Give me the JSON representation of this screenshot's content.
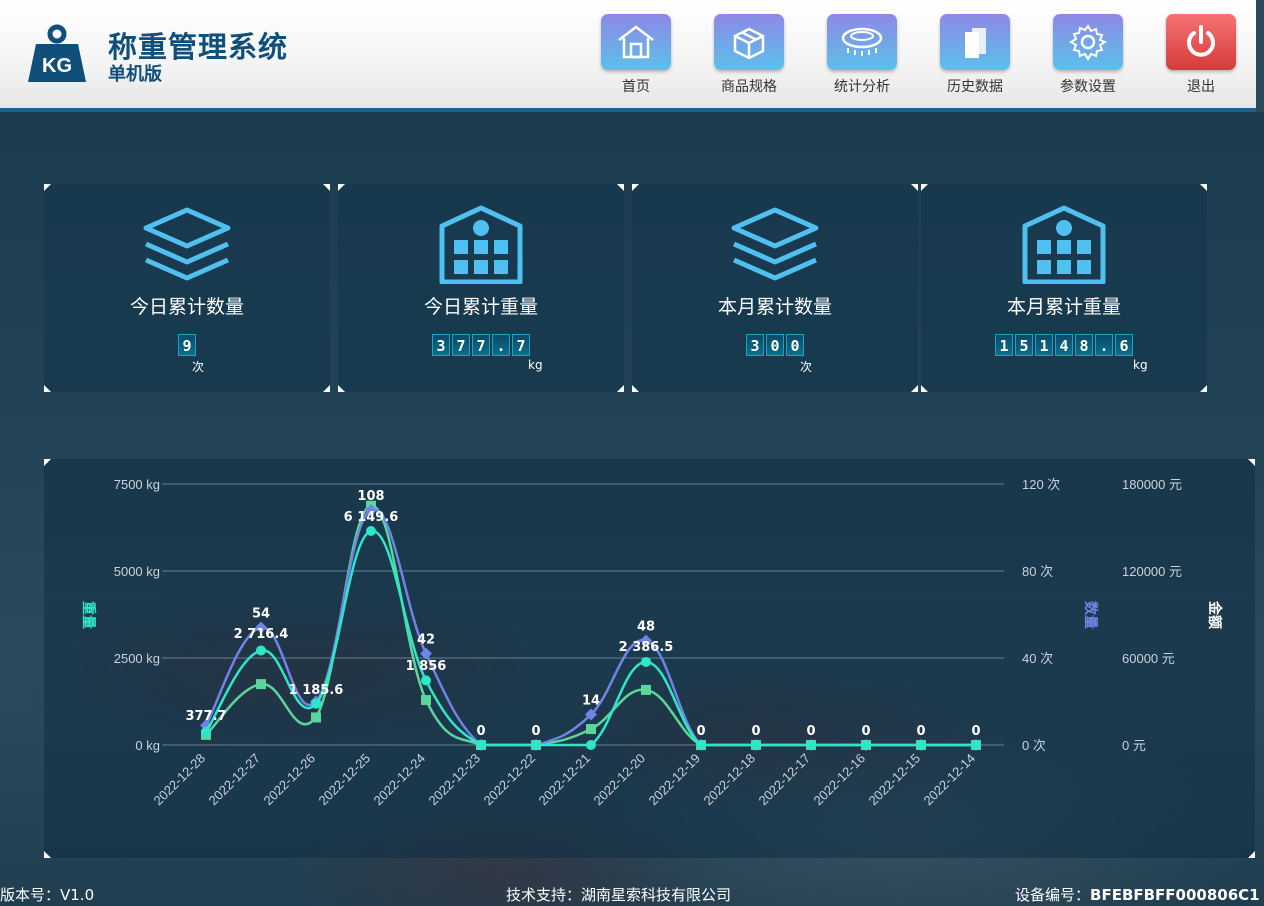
{
  "app": {
    "title": "称重管理系统",
    "subtitle": "单机版",
    "logo_text": "KG"
  },
  "nav": [
    {
      "label": "首页",
      "icon": "home-icon"
    },
    {
      "label": "商品规格",
      "icon": "box-icon"
    },
    {
      "label": "统计分析",
      "icon": "scale-icon"
    },
    {
      "label": "历史数据",
      "icon": "documents-icon"
    },
    {
      "label": "参数设置",
      "icon": "gear-icon"
    },
    {
      "label": "退出",
      "icon": "power-icon",
      "color": "#e04848"
    }
  ],
  "stats": [
    {
      "label": "今日累计数量",
      "digits": [
        "9"
      ],
      "unit": "次",
      "icon": "layers-icon"
    },
    {
      "label": "今日累计重量",
      "digits": [
        "3",
        "7",
        "7",
        ".",
        "7"
      ],
      "unit": "kg",
      "icon": "building-icon"
    },
    {
      "label": "本月累计数量",
      "digits": [
        "3",
        "0",
        "0"
      ],
      "unit": "次",
      "icon": "layers-icon"
    },
    {
      "label": "本月累计重量",
      "digits": [
        "1",
        "5",
        "1",
        "4",
        "8",
        ".",
        "6"
      ],
      "unit": "kg",
      "icon": "building-icon"
    }
  ],
  "chart_data": {
    "type": "line",
    "categories": [
      "2022-12-28",
      "2022-12-27",
      "2022-12-26",
      "2022-12-25",
      "2022-12-24",
      "2022-12-23",
      "2022-12-22",
      "2022-12-21",
      "2022-12-20",
      "2022-12-19",
      "2022-12-18",
      "2022-12-17",
      "2022-12-16",
      "2022-12-15",
      "2022-12-14"
    ],
    "y_left": {
      "label": "重量",
      "ticks": [
        "0 kg",
        "2500 kg",
        "5000 kg",
        "7500 kg"
      ],
      "range": [
        0,
        7500
      ]
    },
    "y_right1": {
      "label": "数量",
      "ticks": [
        "0 次",
        "40 次",
        "80 次",
        "120 次"
      ],
      "range": [
        0,
        120
      ]
    },
    "y_right2": {
      "label": "金额",
      "ticks": [
        "0 元",
        "60000 元",
        "120000 元",
        "180000 元"
      ],
      "range": [
        0,
        180000
      ]
    },
    "series": [
      {
        "name": "重量",
        "axis": "left",
        "color": "#2ee6c8",
        "values": [
          377.7,
          2716.4,
          1185.6,
          6149.6,
          1856,
          0,
          0,
          0,
          2386.5,
          0,
          0,
          0,
          0,
          0,
          0
        ],
        "labels": [
          "377.7",
          "2 716.4",
          "1 185.6",
          "6 149.6",
          "1 856",
          "",
          "",
          "",
          "2 386.5",
          "",
          "",
          "",
          "",
          "",
          ""
        ]
      },
      {
        "name": "数量",
        "axis": "right1",
        "color": "#6f84e8",
        "values": [
          9,
          54,
          20,
          108,
          42,
          0,
          0,
          14,
          48,
          0,
          0,
          0,
          0,
          0,
          0
        ],
        "labels": [
          "",
          "54",
          "",
          "108",
          "42",
          "0",
          "0",
          "14",
          "48",
          "0",
          "0",
          "0",
          "0",
          "0",
          "0"
        ]
      },
      {
        "name": "金额",
        "axis": "right2",
        "color": "#5bd69a",
        "values": [
          7000,
          42000,
          19000,
          165000,
          31000,
          0,
          0,
          11000,
          38000,
          0,
          0,
          0,
          0,
          0,
          0
        ],
        "labels": []
      }
    ],
    "grid": true
  },
  "footer": {
    "version_label": "版本号：V1.0",
    "support_label": "技术支持：湖南星索科技有限公司",
    "device_prefix": "设备编号：",
    "device_id": "BFEBFBFF000806C1"
  }
}
